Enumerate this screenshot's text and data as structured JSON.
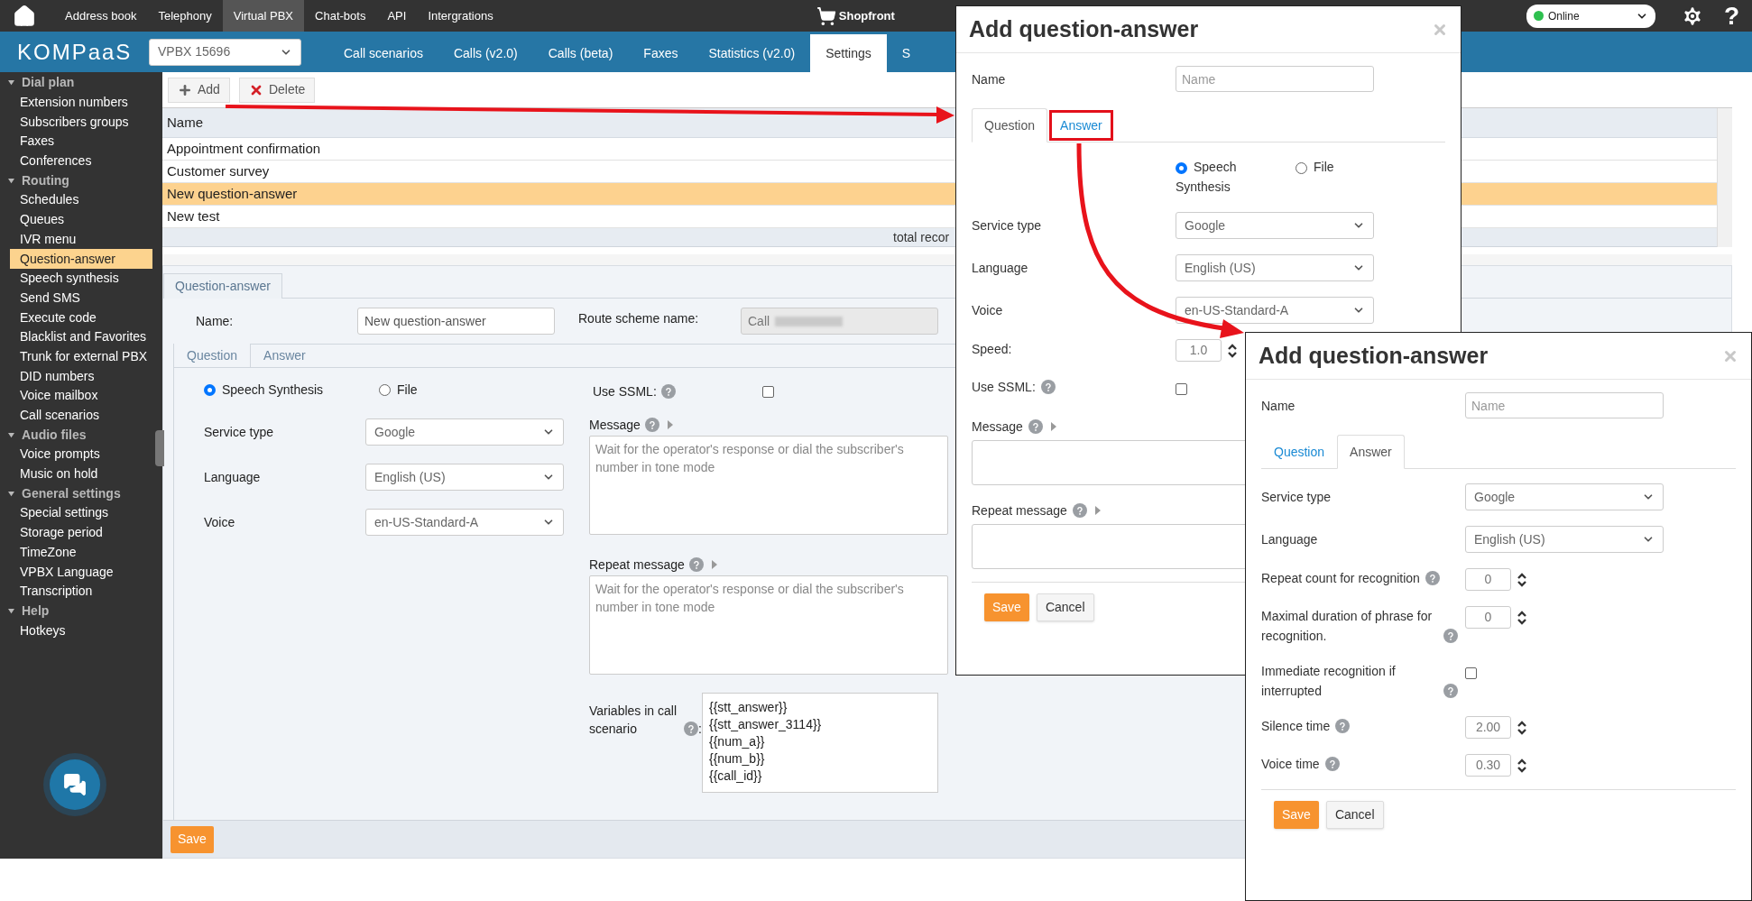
{
  "top_nav": {
    "items": [
      {
        "label": "Address book",
        "selected": false
      },
      {
        "label": "Telephony",
        "selected": false
      },
      {
        "label": "Virtual PBX",
        "selected": true
      },
      {
        "label": "Chat-bots",
        "selected": false
      },
      {
        "label": "API",
        "selected": false
      },
      {
        "label": "Intergrations",
        "selected": false
      }
    ],
    "shop": "Shopfront",
    "status": "Online",
    "help": "?"
  },
  "header": {
    "logo": "KOMPaaS",
    "pbx": "VPBX 15696",
    "tabs": [
      {
        "label": "Call scenarios",
        "selected": false
      },
      {
        "label": "Calls (v2.0)",
        "selected": false
      },
      {
        "label": "Calls (beta)",
        "selected": false
      },
      {
        "label": "Faxes",
        "selected": false
      },
      {
        "label": "Statistics (v2.0)",
        "selected": false
      },
      {
        "label": "Settings",
        "selected": true
      },
      {
        "label": "S",
        "selected": false
      }
    ]
  },
  "sidebar": {
    "groups": [
      {
        "title": "Dial plan",
        "expanded": true,
        "items": [
          {
            "label": "Extension numbers",
            "selected": false
          },
          {
            "label": "Subscribers groups",
            "selected": false
          },
          {
            "label": "Faxes",
            "selected": false
          },
          {
            "label": "Conferences",
            "selected": false
          }
        ]
      },
      {
        "title": "Routing",
        "expanded": true,
        "items": [
          {
            "label": "Schedules",
            "selected": false
          },
          {
            "label": "Queues",
            "selected": false
          },
          {
            "label": "IVR menu",
            "selected": false
          },
          {
            "label": "Question-answer",
            "selected": true
          },
          {
            "label": "Speech synthesis",
            "selected": false
          },
          {
            "label": "Send SMS",
            "selected": false
          },
          {
            "label": "Execute code",
            "selected": false
          },
          {
            "label": "Blacklist and Favorites",
            "selected": false
          },
          {
            "label": "Trunk for external PBX",
            "selected": false
          },
          {
            "label": "DID numbers",
            "selected": false
          },
          {
            "label": "Voice mailbox",
            "selected": false
          },
          {
            "label": "Call scenarios",
            "selected": false
          }
        ]
      },
      {
        "title": "Audio files",
        "expanded": true,
        "items": [
          {
            "label": "Voice prompts",
            "selected": false
          },
          {
            "label": "Music on hold",
            "selected": false
          }
        ]
      },
      {
        "title": "General settings",
        "expanded": true,
        "items": [
          {
            "label": "Special settings",
            "selected": false
          },
          {
            "label": "Storage period",
            "selected": false
          },
          {
            "label": "TimeZone",
            "selected": false
          },
          {
            "label": "VPBX Language",
            "selected": false
          },
          {
            "label": "Transcription",
            "selected": false
          }
        ]
      },
      {
        "title": "Help",
        "expanded": true,
        "items": [
          {
            "label": "Hotkeys",
            "selected": false
          }
        ]
      }
    ]
  },
  "toolbar": {
    "buttons": [
      {
        "kind": "add",
        "label": "Add"
      },
      {
        "kind": "delete",
        "label": "Delete"
      }
    ]
  },
  "table": {
    "columns": [
      "Name"
    ],
    "rows": [
      {
        "name": "Appointment confirmation",
        "selected": false
      },
      {
        "name": "Customer survey",
        "selected": false
      },
      {
        "name": "New question-answer",
        "selected": true
      },
      {
        "name": "New test",
        "selected": false
      }
    ],
    "footer": "total recor"
  },
  "form": {
    "tab": "Question-answer",
    "name_label": "Name:",
    "name_value": "New question-answer",
    "route_label": "Route scheme name:",
    "route_value": "Call",
    "tabs": [
      {
        "label": "Question",
        "selected": true
      },
      {
        "label": "Answer",
        "selected": false
      }
    ],
    "radios": [
      {
        "label": "Speech Synthesis",
        "selected": true
      },
      {
        "label": "File",
        "selected": false
      }
    ],
    "selects": [
      {
        "label": "Service type",
        "value": "Google"
      },
      {
        "label": "Language",
        "value": "English (US)"
      },
      {
        "label": "Voice",
        "value": "en-US-Standard-A"
      }
    ],
    "ssml": {
      "label": "Use SSML:",
      "checked": false
    },
    "messages": [
      {
        "label": "Message",
        "placeholder": "Wait for the operator's response or dial the subscriber's number in tone mode"
      },
      {
        "label": "Repeat message",
        "placeholder": "Wait for the operator's response or dial the subscriber's number in tone mode"
      }
    ],
    "variables": {
      "label": "Variables in call scenario",
      "label_end": ":",
      "values": [
        "{{stt_answer}}",
        "{{stt_answer_3114}}",
        "{{num_a}}",
        "{{num_b}}",
        "{{call_id}}"
      ]
    },
    "save": "Save"
  },
  "dialogs": [
    {
      "title": "Add question-answer",
      "name_label": "Name",
      "name_placeholder": "Name",
      "tabs": [
        {
          "label": "Question",
          "selected": true,
          "highlighted": false
        },
        {
          "label": "Answer",
          "selected": false,
          "highlighted": true
        }
      ],
      "rows": [
        {
          "kind": "radios",
          "options": [
            {
              "label": "Speech Synthesis",
              "selected": true
            },
            {
              "label": "File",
              "selected": false
            }
          ]
        },
        {
          "kind": "select",
          "label": "Service type",
          "value": "Google"
        },
        {
          "kind": "select",
          "label": "Language",
          "value": "English (US)"
        },
        {
          "kind": "select",
          "label": "Voice",
          "value": "en-US-Standard-A"
        },
        {
          "kind": "number",
          "label": "Speed:",
          "value": "1.0",
          "help": false
        },
        {
          "kind": "checkbox",
          "label": "Use SSML:",
          "help": true,
          "checked": false
        },
        {
          "kind": "textarea",
          "label": "Message",
          "help": true
        },
        {
          "kind": "textarea",
          "label": "Repeat message",
          "help": true
        }
      ],
      "save": "Save",
      "cancel": "Cancel"
    },
    {
      "title": "Add question-answer",
      "name_label": "Name",
      "name_placeholder": "Name",
      "tabs": [
        {
          "label": "Question",
          "selected": false,
          "highlighted": false
        },
        {
          "label": "Answer",
          "selected": true,
          "highlighted": false
        }
      ],
      "rows": [
        {
          "kind": "select",
          "label": "Service type",
          "value": "Google"
        },
        {
          "kind": "select",
          "label": "Language",
          "value": "English (US)"
        },
        {
          "kind": "number",
          "label": "Repeat count for recognition",
          "value": "0",
          "help": true
        },
        {
          "kind": "number",
          "label": "Maximal duration of phrase for recognition.",
          "value": "0",
          "help": true
        },
        {
          "kind": "checkbox",
          "label": "Immediate recognition if interrupted",
          "help": true,
          "checked": false
        },
        {
          "kind": "number",
          "label": "Silence time",
          "value": "2.00",
          "help": true
        },
        {
          "kind": "number",
          "label": "Voice time",
          "value": "0.30",
          "help": true
        }
      ],
      "save": "Save",
      "cancel": "Cancel"
    }
  ]
}
